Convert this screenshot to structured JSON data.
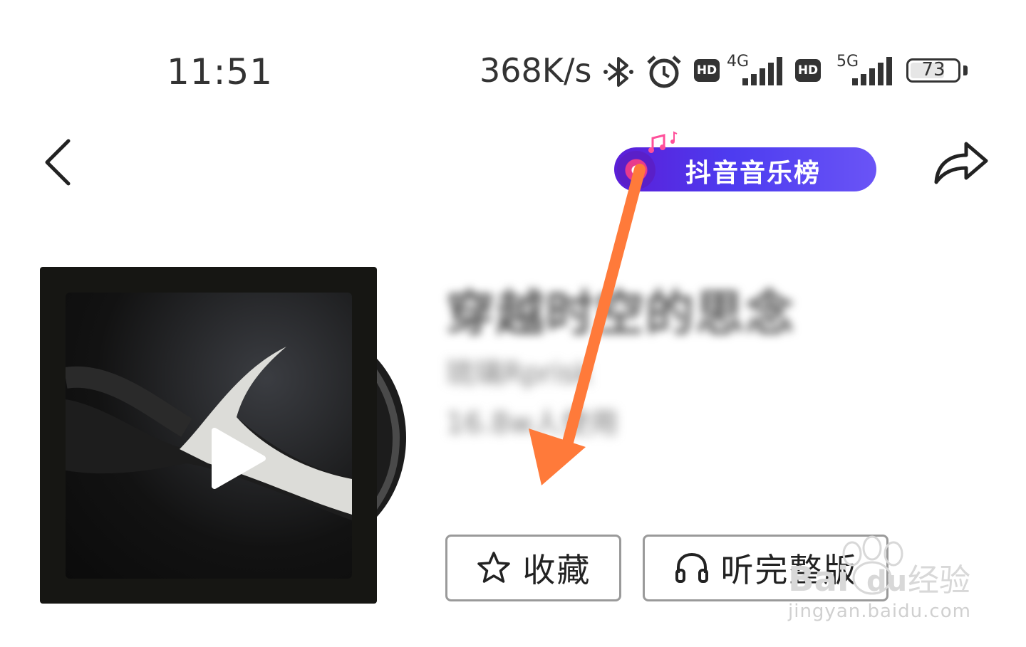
{
  "status_bar": {
    "time": "11:51",
    "net_speed": "368K/s",
    "hd_badge": "HD",
    "net_4g": "4G",
    "net_5g": "5G",
    "battery": "73",
    "battery_level": 0.73
  },
  "nav": {
    "back_icon": "chevron-left-icon",
    "share_icon": "share-icon"
  },
  "chart_badge": {
    "label": "抖音音乐榜",
    "colors": {
      "start": "#5b1ed8",
      "end": "#6a54f6",
      "disc": "#e83a8d"
    }
  },
  "song": {
    "title": "穿越时空的思念",
    "artist": "琉璃Rprisk",
    "plays": "16.8w人使用"
  },
  "actions": {
    "favorite_label": "收藏",
    "favorite_icon": "star-icon",
    "full_label": "听完整版",
    "full_icon": "headphones-icon"
  },
  "annotation": {
    "arrow_color": "#ff7a3a"
  },
  "watermark": {
    "brand": "Baidu经验",
    "url": "jingyan.baidu.com"
  }
}
